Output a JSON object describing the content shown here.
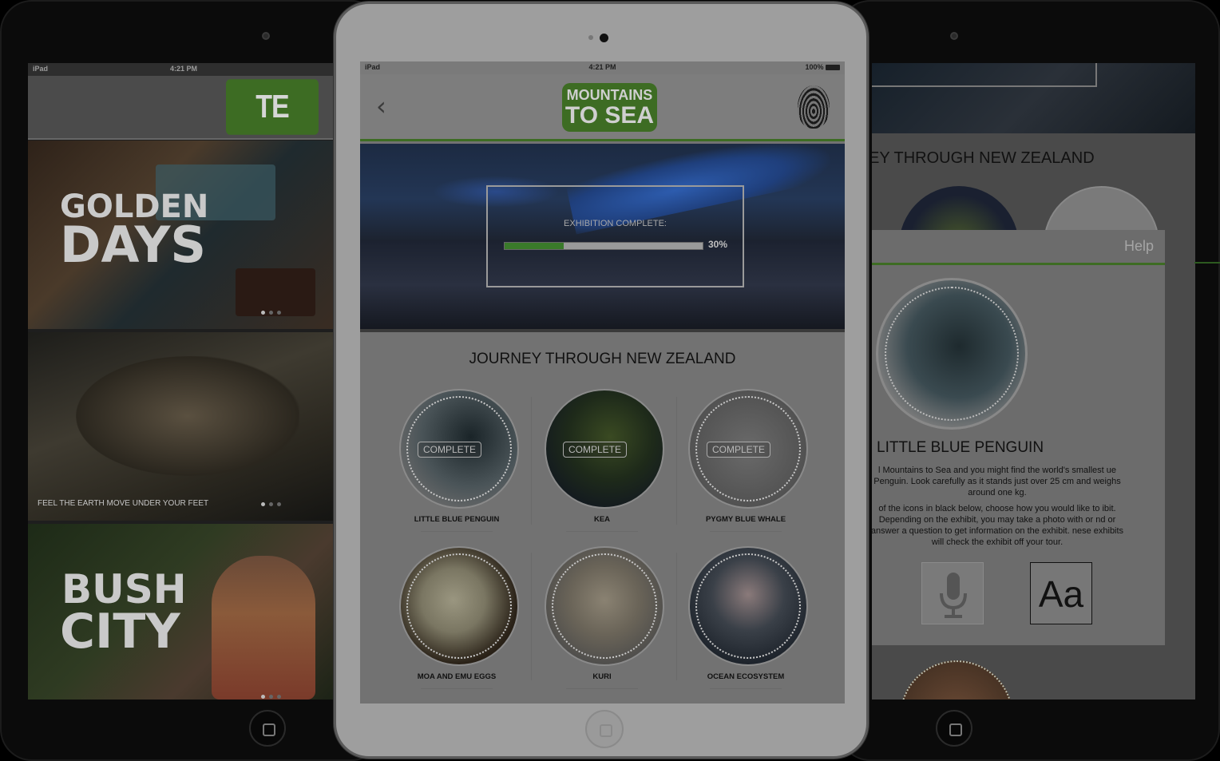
{
  "left_device": {
    "status": {
      "carrier": "iPad",
      "time": "4:21 PM"
    },
    "logo": "TE PAPA",
    "banners": [
      {
        "title_line1": "GOLDEN",
        "title_line2": "DAYS",
        "caption": ""
      },
      {
        "title_line1": "",
        "title_line2": "",
        "caption": "FEEL THE EARTH MOVE UNDER YOUR FEET"
      },
      {
        "title_line1": "BUSH",
        "title_line2": "CITY",
        "caption": ""
      }
    ]
  },
  "center_device": {
    "status": {
      "carrier": "iPad",
      "time": "4:21 PM",
      "battery": "100%"
    },
    "back_label": "‹",
    "logo_line1": "MOUNTAINS",
    "logo_line2": "TO SEA",
    "progress": {
      "label": "EXHIBITION COMPLETE:",
      "percent_text": "30%",
      "percent": 30
    },
    "section_heading": "JOURNEY THROUGH NEW ZEALAND",
    "exhibits": [
      {
        "name": "LITTLE BLUE PENGUIN",
        "status": "COMPLETE"
      },
      {
        "name": "KEA",
        "status": "COMPLETE"
      },
      {
        "name": "PYGMY BLUE WHALE",
        "status": "COMPLETE"
      },
      {
        "name": "MOA AND EMU EGGS",
        "status": ""
      },
      {
        "name": "KURI",
        "status": ""
      },
      {
        "name": "OCEAN ECOSYSTEM",
        "status": ""
      }
    ]
  },
  "right_device": {
    "heading": "EY THROUGH NEW ZEALAND",
    "help_label": "Help",
    "exhibit_title": "LITTLE BLUE PENGUIN",
    "paragraph1": "l Mountains to Sea and you might find the world's smallest ue Penguin. Look carefully as it stands just over 25 cm and weighs around one kg.",
    "paragraph2": "of the icons in black below, choose how you would like to ibit. Depending on the exhibit, you may take a photo with or nd or answer a question to get information on the exhibit. nese exhibits will check the exhibit off your tour.",
    "text_tool_label": "Aa"
  }
}
